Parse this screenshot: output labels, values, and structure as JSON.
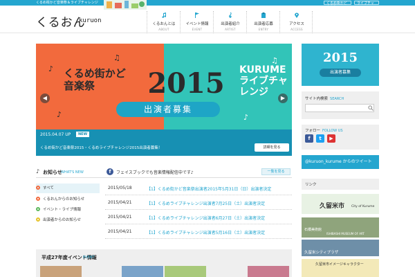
{
  "topbar": {
    "tagline": "くるめ街かど音楽祭＆ライブチャレンジ",
    "link1": "くるめ街かど音楽祭",
    "link2": "ライブチャレンジ"
  },
  "header": {
    "logo": "くるおん",
    "logo_sub": "kuruon"
  },
  "nav": [
    {
      "label": "くるおんとは",
      "sub": "ABOUT",
      "icon": "music-note-icon"
    },
    {
      "label": "イベント情報",
      "sub": "EVENT",
      "icon": "flag-icon"
    },
    {
      "label": "出演者紹介",
      "sub": "ARTIST",
      "icon": "treble-clef-icon"
    },
    {
      "label": "出演者応募",
      "sub": "ENTRY",
      "icon": "clipboard-icon"
    },
    {
      "label": "アクセス",
      "sub": "ACCESS",
      "icon": "map-pin-icon"
    }
  ],
  "hero": {
    "title_left": "くるめ街かど音楽祭",
    "year": "2015",
    "title_right_1": "KURUME",
    "title_right_2": "ライブチャレンジ",
    "banner": "出演者募集",
    "date": "2015.04.07 UP",
    "new_badge": "NEW",
    "caption": "くるめ街かど音楽祭2015・くるめライブチャレンジ2015出演者募集！",
    "detail_button": "詳細を見る"
  },
  "side": {
    "banner_year": "2015",
    "banner_recruit": "出演者募集",
    "search_title": "サイト内検索",
    "search_en": "SEARCH",
    "search_placeholder": "",
    "follow_title": "フォロー",
    "follow_en": "FOLLOW US",
    "twitter": "@kuruon_kurume からのツイート",
    "links_title": "リンク",
    "link1": "久留米市",
    "link1_sub": "City of Kurume",
    "link2": "石橋美術館",
    "link2_sub": "ISHIBASHI MUSEUM OF ART",
    "link3": "久留米シティプラザ",
    "link4": "久留米市イメージキャラクター"
  },
  "news": {
    "title": "お知らせ",
    "title_en": "WHAT'S NEW",
    "fb_text": "フェイスブックでも音楽情報配信中です♪",
    "more": "一覧を見る",
    "categories": [
      {
        "label": "すべて"
      },
      {
        "label": "くるおんからのお知らせ"
      },
      {
        "label": "イベント・ライブ情報"
      },
      {
        "label": "出演者からのお知らせ"
      }
    ],
    "items": [
      {
        "date": "2015/05/18",
        "text": "【1】くるめ街かど音楽祭出演者2015年5月31日（日）出演者決定"
      },
      {
        "date": "2015/04/21",
        "text": "【1】くるめライブチャレンジ出演者7月25日（土）出演者決定"
      },
      {
        "date": "2015/04/21",
        "text": "【1】くるめライブチャレンジ出演者6月27日（土）出演者決定"
      },
      {
        "date": "2015/04/21",
        "text": "【1】くるめライブチャレンジ出演者5月16日（土）出演者決定"
      }
    ]
  },
  "event": {
    "title": "平成27年度イベント情報",
    "title_en": "EVENT"
  },
  "colors": {
    "accent": "#24a6cf",
    "hero_left": "#f26a3d",
    "hero_right": "#32c4b8",
    "facebook": "#3b5998"
  }
}
